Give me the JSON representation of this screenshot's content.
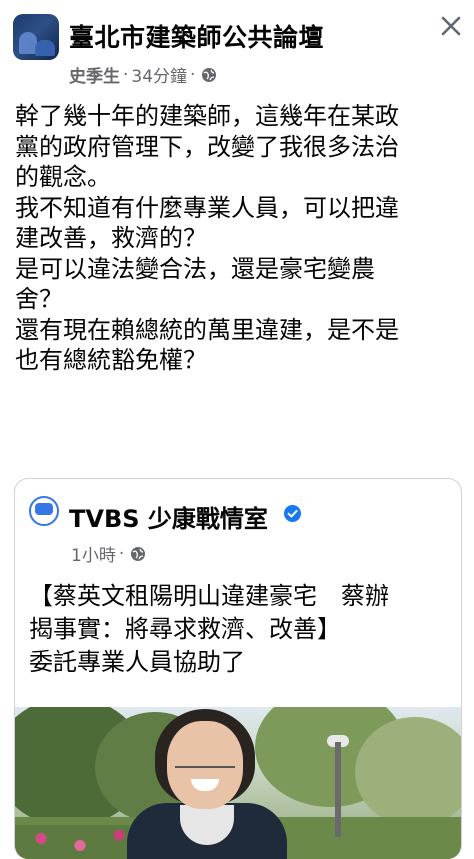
{
  "group": {
    "name": "臺北市建築師公共論壇",
    "author": "史季生",
    "time": "34分鐘",
    "separator": "·"
  },
  "post": {
    "lines": [
      "幹了幾十年的建築師，這幾年在某政",
      "黨的政府管理下，改變了我很多法治",
      "的觀念。",
      "我不知道有什麼專業人員，可以把違",
      "建改善，救濟的？",
      "是可以違法變合法，還是豪宅變農",
      "舍？",
      "還有現在賴總統的萬里違建，是不是",
      "也有總統豁免權？"
    ]
  },
  "shared": {
    "page_name": "TVBS 少康戰情室",
    "time": "1小時",
    "separator": "·",
    "lines": [
      "【蔡英文租陽明山違建豪宅　蔡辦",
      "揭事實：將尋求救濟、改善】",
      "委託專業人員協助了"
    ]
  },
  "icons": {
    "close": "close-icon",
    "audience": "globe-icon",
    "verified": "verified-badge-icon"
  },
  "colors": {
    "text": "#050505",
    "meta": "#65676b",
    "verified": "#1877f2"
  }
}
